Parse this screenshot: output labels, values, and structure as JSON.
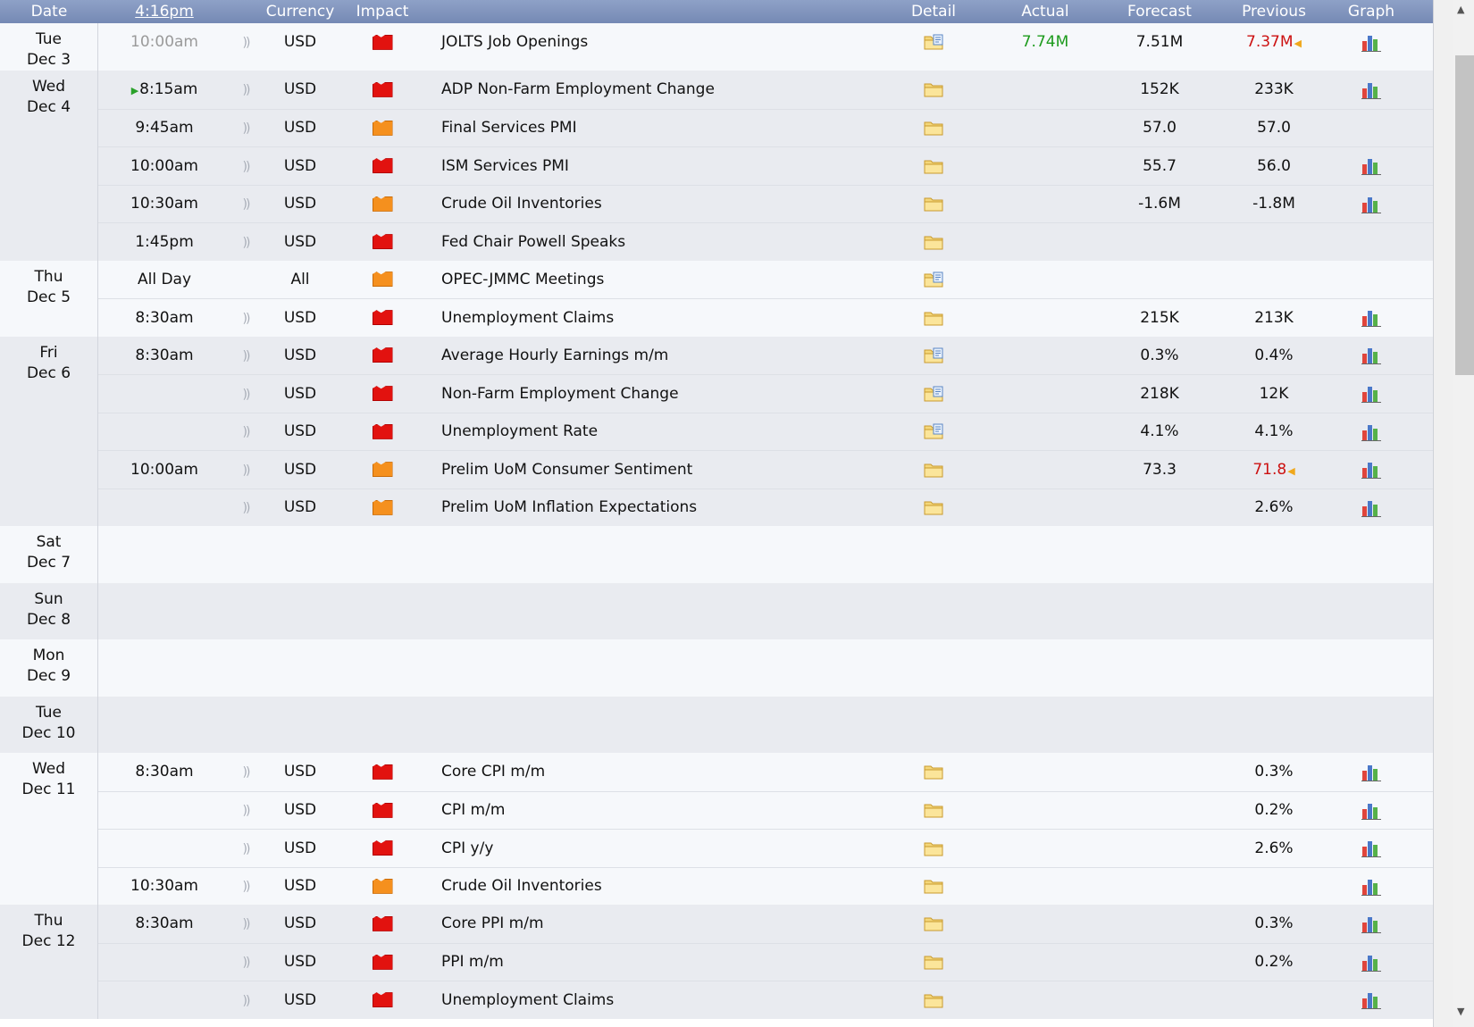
{
  "header": {
    "date": "Date",
    "time": "4:16pm",
    "currency": "Currency",
    "impact": "Impact",
    "detail": "Detail",
    "actual": "Actual",
    "forecast": "Forecast",
    "previous": "Previous",
    "graph": "Graph"
  },
  "colors": {
    "header_bg": "#7f93bd",
    "actual_better": "#1d9b1d",
    "revised_worse": "#cc1111",
    "impact_high": "#e2120f",
    "impact_medium": "#f5901e"
  },
  "days": [
    {
      "dow": "Tue",
      "date": "Dec 3",
      "events": [
        {
          "time": "10:00am",
          "past": true,
          "currency": "USD",
          "impact": "high",
          "name": "JOLTS Job Openings",
          "detail": "report",
          "actual": "7.74M",
          "actual_color": "green",
          "forecast": "7.51M",
          "previous": "7.37M",
          "previous_color": "red",
          "revised": true,
          "graph": true
        }
      ]
    },
    {
      "dow": "Wed",
      "date": "Dec 4",
      "events": [
        {
          "time": "8:15am",
          "next": true,
          "currency": "USD",
          "impact": "high",
          "name": "ADP Non-Farm Employment Change",
          "detail": "folder",
          "actual": "",
          "forecast": "152K",
          "previous": "233K",
          "graph": true
        },
        {
          "time": "9:45am",
          "currency": "USD",
          "impact": "medium",
          "name": "Final Services PMI",
          "detail": "folder",
          "actual": "",
          "forecast": "57.0",
          "previous": "57.0",
          "graph": false
        },
        {
          "time": "10:00am",
          "currency": "USD",
          "impact": "high",
          "name": "ISM Services PMI",
          "detail": "folder",
          "actual": "",
          "forecast": "55.7",
          "previous": "56.0",
          "graph": true
        },
        {
          "time": "10:30am",
          "currency": "USD",
          "impact": "medium",
          "name": "Crude Oil Inventories",
          "detail": "folder",
          "actual": "",
          "forecast": "-1.6M",
          "previous": "-1.8M",
          "graph": true
        },
        {
          "time": "1:45pm",
          "currency": "USD",
          "impact": "high",
          "name": "Fed Chair Powell Speaks",
          "detail": "folder",
          "actual": "",
          "forecast": "",
          "previous": "",
          "graph": false
        }
      ]
    },
    {
      "dow": "Thu",
      "date": "Dec 5",
      "events": [
        {
          "time": "All Day",
          "currency": "All",
          "impact": "medium",
          "name": "OPEC-JMMC Meetings",
          "detail": "report",
          "nosound": true,
          "actual": "",
          "forecast": "",
          "previous": "",
          "graph": false
        },
        {
          "time": "8:30am",
          "currency": "USD",
          "impact": "high",
          "name": "Unemployment Claims",
          "detail": "folder",
          "actual": "",
          "forecast": "215K",
          "previous": "213K",
          "graph": true
        }
      ]
    },
    {
      "dow": "Fri",
      "date": "Dec 6",
      "events": [
        {
          "time": "8:30am",
          "currency": "USD",
          "impact": "high",
          "name": "Average Hourly Earnings m/m",
          "detail": "report",
          "actual": "",
          "forecast": "0.3%",
          "previous": "0.4%",
          "graph": true
        },
        {
          "time": "",
          "currency": "USD",
          "impact": "high",
          "name": "Non-Farm Employment Change",
          "detail": "report",
          "actual": "",
          "forecast": "218K",
          "previous": "12K",
          "graph": true
        },
        {
          "time": "",
          "currency": "USD",
          "impact": "high",
          "name": "Unemployment Rate",
          "detail": "report",
          "actual": "",
          "forecast": "4.1%",
          "previous": "4.1%",
          "graph": true
        },
        {
          "time": "10:00am",
          "currency": "USD",
          "impact": "medium",
          "name": "Prelim UoM Consumer Sentiment",
          "detail": "folder",
          "actual": "",
          "forecast": "73.3",
          "previous": "71.8",
          "previous_color": "red",
          "revised": true,
          "graph": true
        },
        {
          "time": "",
          "currency": "USD",
          "impact": "medium",
          "name": "Prelim UoM Inflation Expectations",
          "detail": "folder",
          "actual": "",
          "forecast": "",
          "previous": "2.6%",
          "graph": true
        }
      ]
    },
    {
      "dow": "Sat",
      "date": "Dec 7",
      "events": []
    },
    {
      "dow": "Sun",
      "date": "Dec 8",
      "events": []
    },
    {
      "dow": "Mon",
      "date": "Dec 9",
      "events": []
    },
    {
      "dow": "Tue",
      "date": "Dec 10",
      "events": []
    },
    {
      "dow": "Wed",
      "date": "Dec 11",
      "events": [
        {
          "time": "8:30am",
          "currency": "USD",
          "impact": "high",
          "name": "Core CPI m/m",
          "detail": "folder",
          "actual": "",
          "forecast": "",
          "previous": "0.3%",
          "graph": true
        },
        {
          "time": "",
          "currency": "USD",
          "impact": "high",
          "name": "CPI m/m",
          "detail": "folder",
          "actual": "",
          "forecast": "",
          "previous": "0.2%",
          "graph": true
        },
        {
          "time": "",
          "currency": "USD",
          "impact": "high",
          "name": "CPI y/y",
          "detail": "folder",
          "actual": "",
          "forecast": "",
          "previous": "2.6%",
          "graph": true
        },
        {
          "time": "10:30am",
          "currency": "USD",
          "impact": "medium",
          "name": "Crude Oil Inventories",
          "detail": "folder",
          "actual": "",
          "forecast": "",
          "previous": "",
          "graph": true
        }
      ]
    },
    {
      "dow": "Thu",
      "date": "Dec 12",
      "events": [
        {
          "time": "8:30am",
          "currency": "USD",
          "impact": "high",
          "name": "Core PPI m/m",
          "detail": "folder",
          "actual": "",
          "forecast": "",
          "previous": "0.3%",
          "graph": true
        },
        {
          "time": "",
          "currency": "USD",
          "impact": "high",
          "name": "PPI m/m",
          "detail": "folder",
          "actual": "",
          "forecast": "",
          "previous": "0.2%",
          "graph": true
        },
        {
          "time": "",
          "currency": "USD",
          "impact": "high",
          "name": "Unemployment Claims",
          "detail": "folder",
          "actual": "",
          "forecast": "",
          "previous": "",
          "graph": true
        }
      ]
    }
  ]
}
